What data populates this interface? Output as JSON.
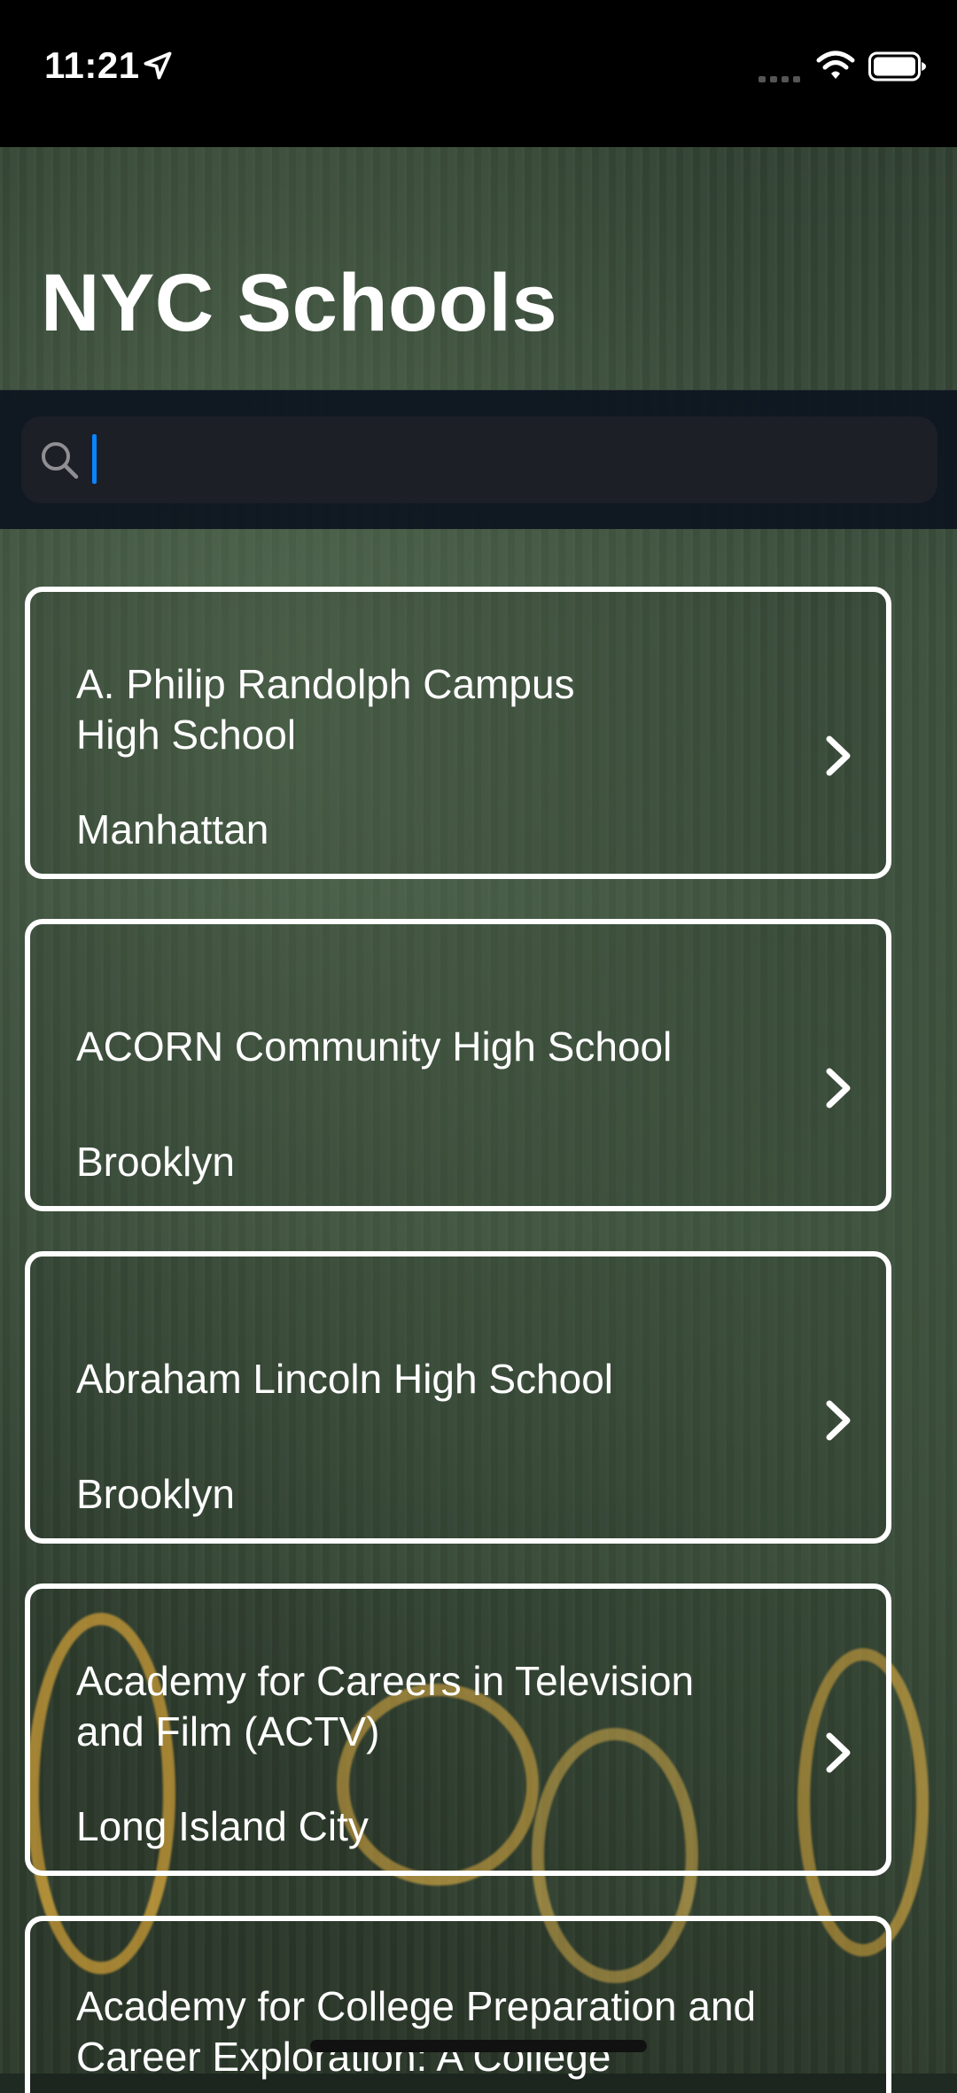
{
  "status_bar": {
    "time": "11:21"
  },
  "nav": {
    "title": "NYC Schools"
  },
  "search": {
    "value": "",
    "placeholder": ""
  },
  "schools": [
    {
      "name": "A. Philip Randolph Campus High School",
      "borough": "Manhattan"
    },
    {
      "name": "ACORN Community High School",
      "borough": "Brooklyn"
    },
    {
      "name": "Abraham Lincoln High School",
      "borough": "Brooklyn"
    },
    {
      "name": "Academy for Careers in Television and Film (ACTV)",
      "borough": "Long Island City"
    },
    {
      "name": "Academy for College Preparation and Career Exploration: A College",
      "borough": ""
    }
  ],
  "icons": {
    "location": "location-arrow-icon",
    "signal": "cellular-signal-icon",
    "wifi": "wifi-icon",
    "battery": "battery-icon",
    "search": "search-icon",
    "chevron": "chevron-right-icon"
  },
  "colors": {
    "accent": "#0a84ff",
    "card_border": "#ffffff",
    "status_bar": "#000000"
  }
}
